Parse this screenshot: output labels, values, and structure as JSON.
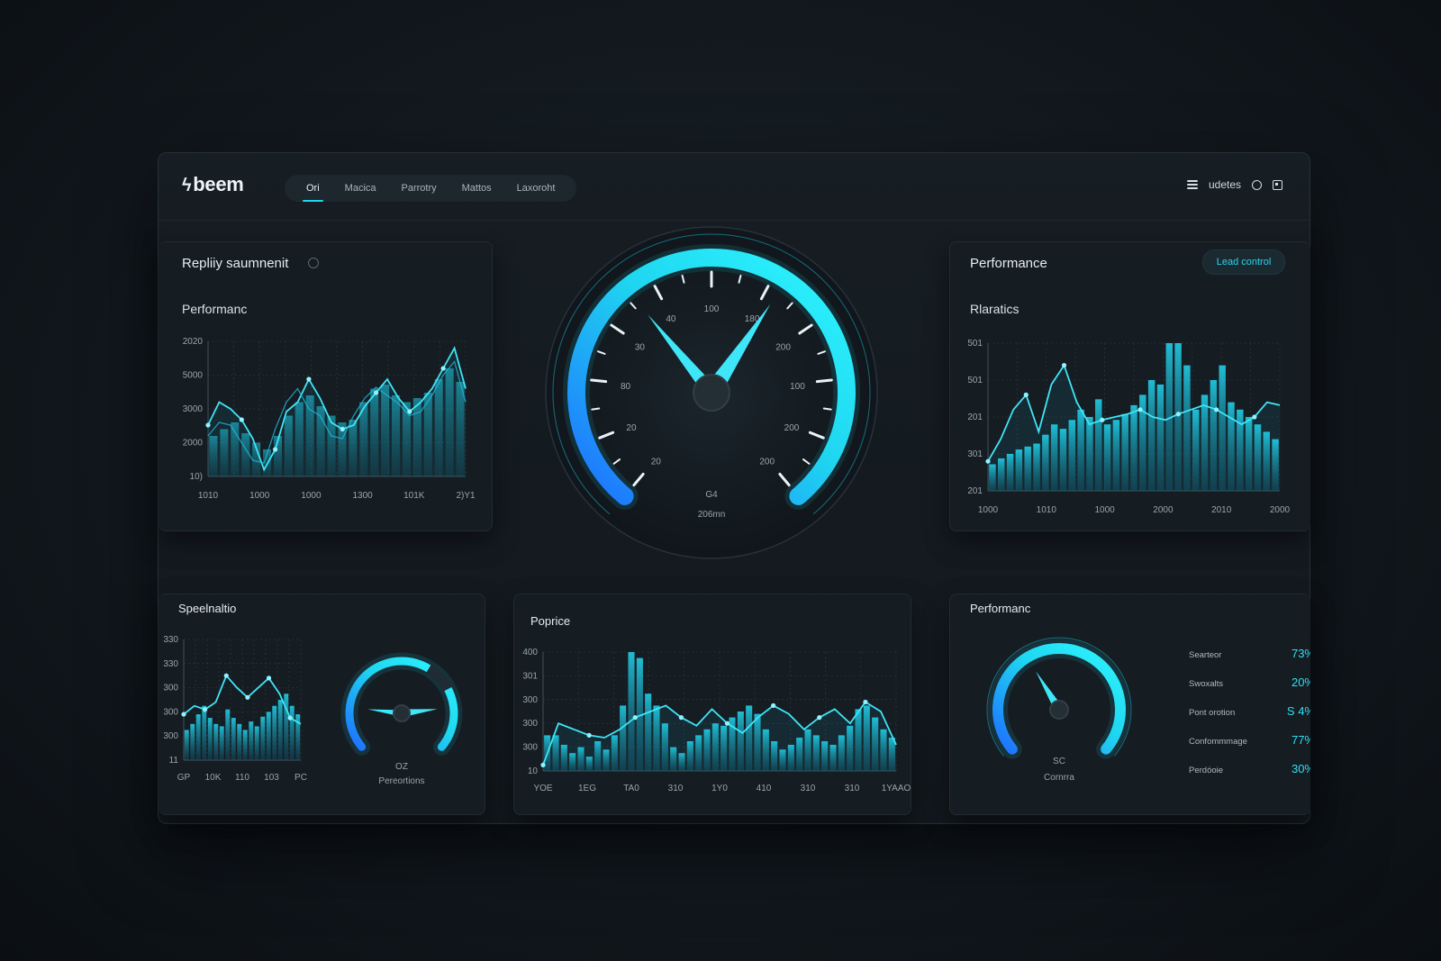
{
  "app": {
    "logo": "beem"
  },
  "nav": {
    "tabs": [
      "Ori",
      "Macica",
      "Parrotry",
      "Mattos",
      "Laxoroht"
    ],
    "active": 0
  },
  "header_right": {
    "label": "udetes"
  },
  "colors": {
    "accent": "#1fd6f0",
    "accent_deep": "#1e6fff",
    "card": "#151c22"
  },
  "cards": {
    "top_left": {
      "title": "Repliiy saumnenit",
      "subtitle": "Performanc"
    },
    "top_right": {
      "title": "Performance",
      "button": "Lead control",
      "subtitle": "Rlaratics"
    },
    "bottom_left": {
      "title": "Speelnaltio"
    },
    "bottom_mid": {
      "title": "Poprice"
    },
    "bottom_right": {
      "title": "Performanc"
    }
  },
  "main_gauge": {
    "ticks": [
      "20",
      "20",
      "80",
      "30",
      "40",
      "100",
      "180",
      "200",
      "100",
      "200",
      "200"
    ],
    "value": "G4",
    "unit": "206mn",
    "needle_fraction": 0.62
  },
  "small_gauge_left": {
    "value": "OZ",
    "label": "Pereortions",
    "needle_fraction": 0.82
  },
  "small_gauge_right": {
    "value": "SC",
    "label": "Cornrra",
    "needle_fraction": 0.38
  },
  "stats": [
    {
      "label": "Searteor",
      "value": "73%"
    },
    {
      "label": "Swoxalts",
      "value": "20%"
    },
    {
      "label": "Pont orotion",
      "value": "S 4%"
    },
    {
      "label": "Confommmage",
      "value": "77%"
    },
    {
      "label": "Perdóoie",
      "value": "30%"
    }
  ],
  "chart_data": [
    {
      "type": "line",
      "title": "Performanc",
      "yticks": [
        "2020",
        "5000",
        "3000",
        "2000",
        "10)"
      ],
      "xticks": [
        "1010",
        "1000",
        "1000",
        "1300",
        "101K",
        "2)Y1"
      ],
      "ylim": [
        0,
        100
      ],
      "series": [
        {
          "values": [
            38,
            55,
            50,
            42,
            28,
            5,
            20,
            48,
            55,
            72,
            58,
            40,
            35,
            38,
            52,
            62,
            72,
            58,
            48,
            55,
            65,
            80,
            95,
            65
          ]
        },
        {
          "values": [
            30,
            40,
            38,
            25,
            12,
            10,
            35,
            55,
            65,
            50,
            45,
            30,
            28,
            45,
            58,
            66,
            60,
            54,
            45,
            48,
            60,
            75,
            85,
            55
          ]
        }
      ],
      "bars": [
        30,
        35,
        40,
        32,
        25,
        20,
        30,
        45,
        55,
        60,
        52,
        45,
        40,
        42,
        55,
        65,
        68,
        60,
        55,
        58,
        62,
        72,
        80,
        70
      ]
    },
    {
      "type": "bar",
      "title": "Rlaratics",
      "yticks": [
        "501",
        "501",
        "201",
        "301",
        "201"
      ],
      "xticks": [
        "1000",
        "1010",
        "1000",
        "2000",
        "2010",
        "2000"
      ],
      "ylim": [
        0,
        100
      ],
      "values": [
        18,
        22,
        25,
        28,
        30,
        32,
        38,
        45,
        42,
        48,
        55,
        50,
        62,
        45,
        48,
        52,
        58,
        65,
        75,
        72,
        100,
        100,
        85,
        55,
        65,
        75,
        85,
        60,
        55,
        50,
        45,
        40,
        35
      ],
      "series": [
        {
          "values": [
            20,
            35,
            55,
            65,
            40,
            72,
            85,
            60,
            45,
            48,
            50,
            52,
            55,
            50,
            48,
            52,
            55,
            58,
            55,
            50,
            45,
            50,
            60,
            58
          ]
        }
      ]
    },
    {
      "type": "bar",
      "title": "Speelnaltio",
      "yticks": [
        "330",
        "330",
        "300",
        "300",
        "300",
        "11"
      ],
      "xticks": [
        "GP",
        "10K",
        "110",
        "103",
        "PC"
      ],
      "ylim": [
        0,
        100
      ],
      "values": [
        25,
        30,
        38,
        45,
        35,
        30,
        28,
        42,
        35,
        30,
        25,
        32,
        28,
        36,
        40,
        45,
        50,
        55,
        45,
        38
      ],
      "series": [
        {
          "values": [
            38,
            45,
            42,
            48,
            70,
            60,
            52,
            60,
            68,
            55,
            35,
            30
          ]
        }
      ]
    },
    {
      "type": "bar",
      "title": "Poprice",
      "yticks": [
        "400",
        "301",
        "300",
        "300",
        "300",
        "10"
      ],
      "xticks": [
        "YOE",
        "1EG",
        "TA0",
        "310",
        "1Y0",
        "410",
        "310",
        "310",
        "1YAAO"
      ],
      "ylim": [
        0,
        100
      ],
      "values": [
        30,
        30,
        22,
        15,
        20,
        12,
        25,
        18,
        30,
        55,
        100,
        95,
        65,
        55,
        40,
        20,
        15,
        25,
        30,
        35,
        40,
        38,
        45,
        50,
        55,
        48,
        35,
        25,
        18,
        22,
        28,
        35,
        30,
        25,
        22,
        30,
        38,
        52,
        55,
        45,
        35,
        28
      ],
      "series": [
        {
          "values": [
            5,
            40,
            35,
            30,
            28,
            35,
            45,
            50,
            55,
            45,
            38,
            52,
            40,
            32,
            45,
            55,
            48,
            35,
            45,
            52,
            40,
            58,
            50,
            22
          ]
        }
      ]
    }
  ]
}
